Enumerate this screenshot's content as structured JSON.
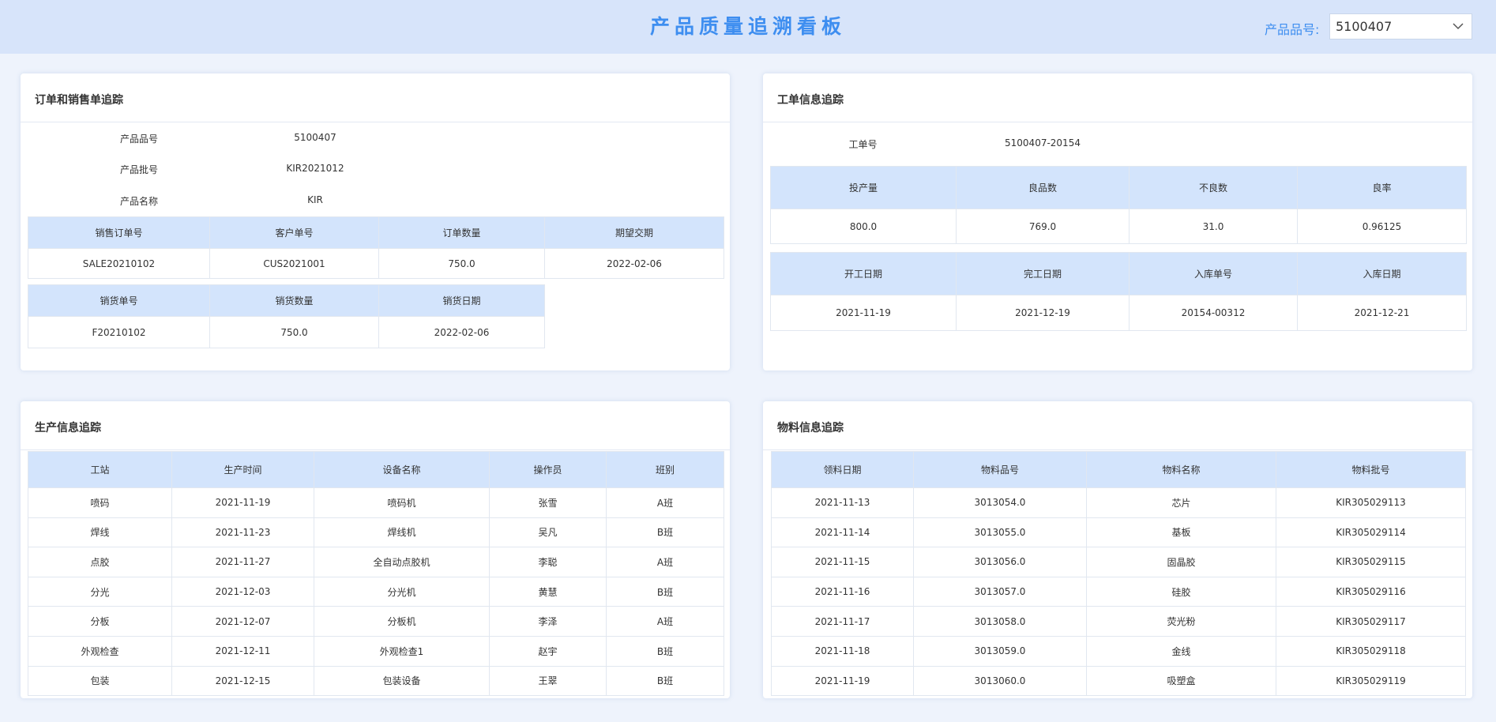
{
  "header": {
    "title": "产品质量追溯看板",
    "selector_label": "产品品号:",
    "selector_value": "5100407"
  },
  "orders": {
    "title": "订单和销售单追踪",
    "info": [
      {
        "label": "产品品号",
        "value": "5100407"
      },
      {
        "label": "产品批号",
        "value": "KIR2021012"
      },
      {
        "label": "产品名称",
        "value": "KIR"
      }
    ],
    "sales_order": {
      "headers": [
        "销售订单号",
        "客户单号",
        "订单数量",
        "期望交期"
      ],
      "row": [
        "SALE20210102",
        "CUS2021001",
        "750.0",
        "2022-02-06"
      ]
    },
    "shipment": {
      "headers": [
        "销货单号",
        "销货数量",
        "销货日期"
      ],
      "row": [
        "F20210102",
        "750.0",
        "2022-02-06"
      ]
    }
  },
  "workorder": {
    "title": "工单信息追踪",
    "wo_label": "工单号",
    "wo_value": "5100407-20154",
    "qty": {
      "headers": [
        "投产量",
        "良品数",
        "不良数",
        "良率"
      ],
      "row": [
        "800.0",
        "769.0",
        "31.0",
        "0.96125"
      ]
    },
    "dates": {
      "headers": [
        "开工日期",
        "完工日期",
        "入库单号",
        "入库日期"
      ],
      "row": [
        "2021-11-19",
        "2021-12-19",
        "20154-00312",
        "2021-12-21"
      ]
    }
  },
  "production": {
    "title": "生产信息追踪",
    "headers": [
      "工站",
      "生产时间",
      "设备名称",
      "操作员",
      "班别"
    ],
    "rows": [
      [
        "喷码",
        "2021-11-19",
        "喷码机",
        "张雪",
        "A班"
      ],
      [
        "焊线",
        "2021-11-23",
        "焊线机",
        "吴凡",
        "B班"
      ],
      [
        "点胶",
        "2021-11-27",
        "全自动点胶机",
        "李聪",
        "A班"
      ],
      [
        "分光",
        "2021-12-03",
        "分光机",
        "黄慧",
        "B班"
      ],
      [
        "分板",
        "2021-12-07",
        "分板机",
        "李泽",
        "A班"
      ],
      [
        "外观检查",
        "2021-12-11",
        "外观检查1",
        "赵宇",
        "B班"
      ],
      [
        "包装",
        "2021-12-15",
        "包装设备",
        "王翠",
        "B班"
      ]
    ]
  },
  "materials": {
    "title": "物料信息追踪",
    "headers": [
      "领料日期",
      "物料品号",
      "物料名称",
      "物料批号"
    ],
    "rows": [
      [
        "2021-11-13",
        "3013054.0",
        "芯片",
        "KIR305029113"
      ],
      [
        "2021-11-14",
        "3013055.0",
        "基板",
        "KIR305029114"
      ],
      [
        "2021-11-15",
        "3013056.0",
        "固晶胶",
        "KIR305029115"
      ],
      [
        "2021-11-16",
        "3013057.0",
        "硅胶",
        "KIR305029116"
      ],
      [
        "2021-11-17",
        "3013058.0",
        "荧光粉",
        "KIR305029117"
      ],
      [
        "2021-11-18",
        "3013059.0",
        "金线",
        "KIR305029118"
      ],
      [
        "2021-11-19",
        "3013060.0",
        "吸塑盒",
        "KIR305029119"
      ]
    ]
  }
}
